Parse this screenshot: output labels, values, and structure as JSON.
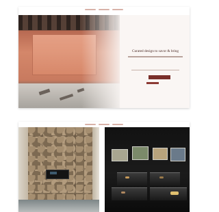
{
  "card1": {
    "hero_title": "Curated design to savor & bring"
  },
  "card2": {},
  "colors": {
    "accent": "#7a2f2a",
    "background": "#faf6f4",
    "dark_gallery": "#121212"
  }
}
